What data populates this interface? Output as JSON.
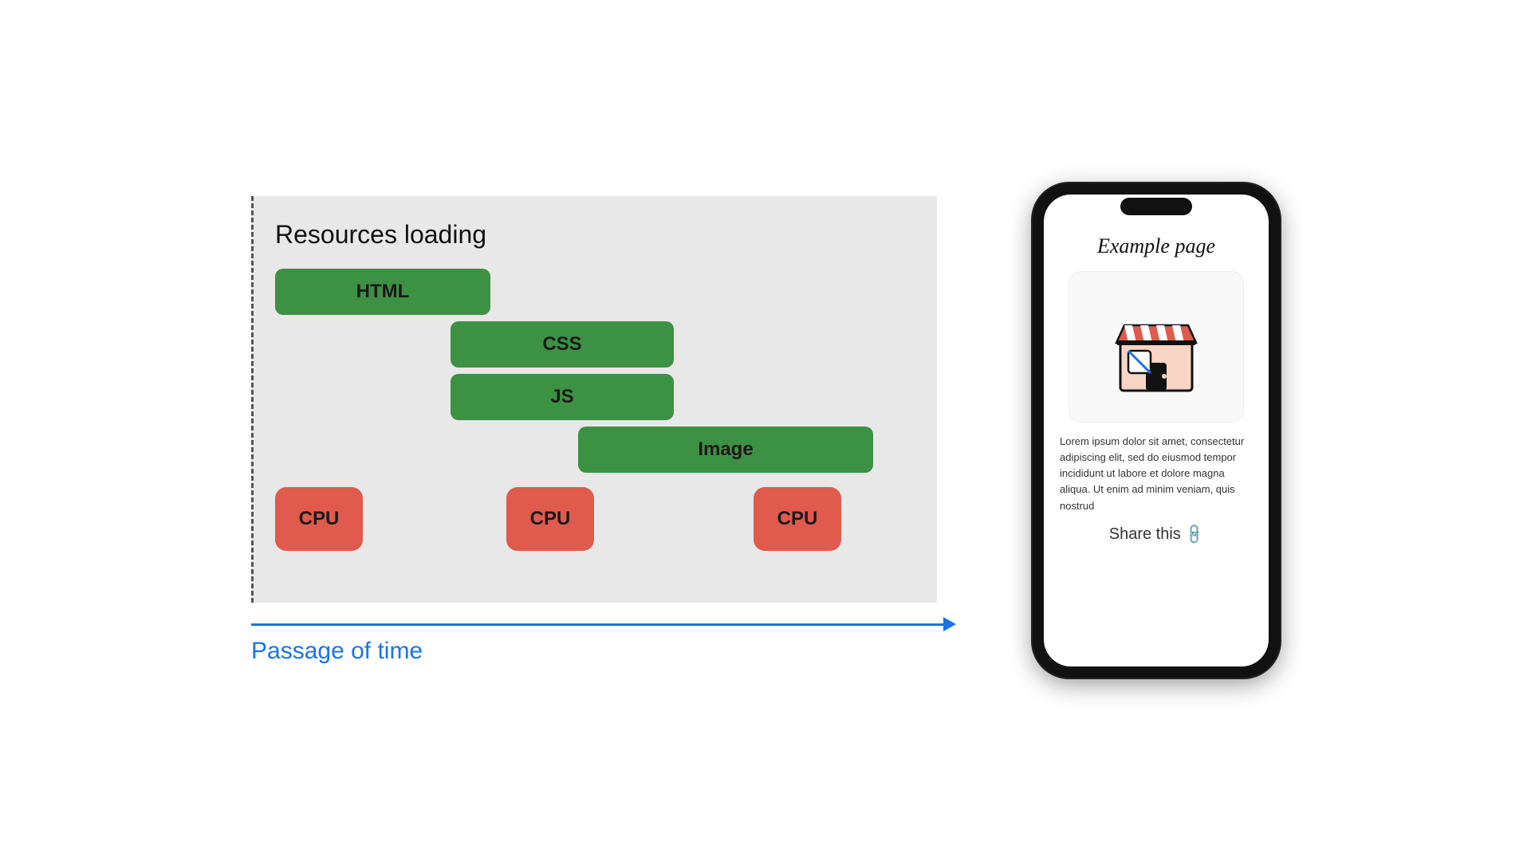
{
  "diagram": {
    "title": "Resources loading",
    "bars": [
      {
        "label": "HTML",
        "class": "bar-html"
      },
      {
        "label": "CSS",
        "class": "bar-css"
      },
      {
        "label": "JS",
        "class": "bar-js"
      },
      {
        "label": "Image",
        "class": "bar-image"
      }
    ],
    "cpu_label": "CPU",
    "time_label": "Passage of time"
  },
  "phone": {
    "page_title": "Example page",
    "lorem_text": "Lorem ipsum dolor sit amet, consectetur adipiscing elit, sed do eiusmod tempor incididunt ut labore et dolore magna aliqua. Ut enim ad minim veniam, quis nostrud",
    "share_label": "Share this",
    "link_icon": "🔗"
  }
}
